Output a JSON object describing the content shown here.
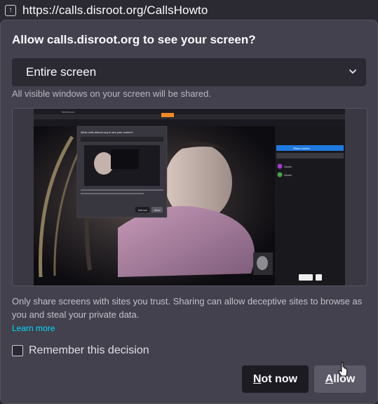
{
  "urlbar": {
    "icon": "screen-share-icon",
    "url": "https://calls.disroot.org/CallsHowto"
  },
  "dialog": {
    "title": "Allow calls.disroot.org to see your screen?",
    "source_select": {
      "value": "Entire screen",
      "icon": "chevron-down-icon"
    },
    "source_description": "All visible windows on your screen will be shared.",
    "preview": {
      "label": "Screen preview",
      "nested_tabs_text": "Nextcloud",
      "nested_prompt_title": "Allow calls.disroot.org to see your screen?",
      "nested_buttons": [
        "Not now",
        "Allow"
      ],
      "sidebar_button": "Share screen",
      "participants": [
        "Guest",
        "Guest"
      ]
    },
    "warning": "Only share screens with sites you trust. Sharing can allow deceptive sites to browse as you and steal your private data.",
    "learn_more": "Learn more",
    "remember_label": "Remember this decision",
    "remember_checked": false,
    "buttons": {
      "not_now": "Not now",
      "allow": "Allow"
    }
  },
  "colors": {
    "panel_bg": "#42414d",
    "select_bg": "#2b2a33",
    "link": "#00ddff",
    "button_primary_bg": "#5b5a66",
    "button_secondary_bg": "#1c1b22"
  }
}
